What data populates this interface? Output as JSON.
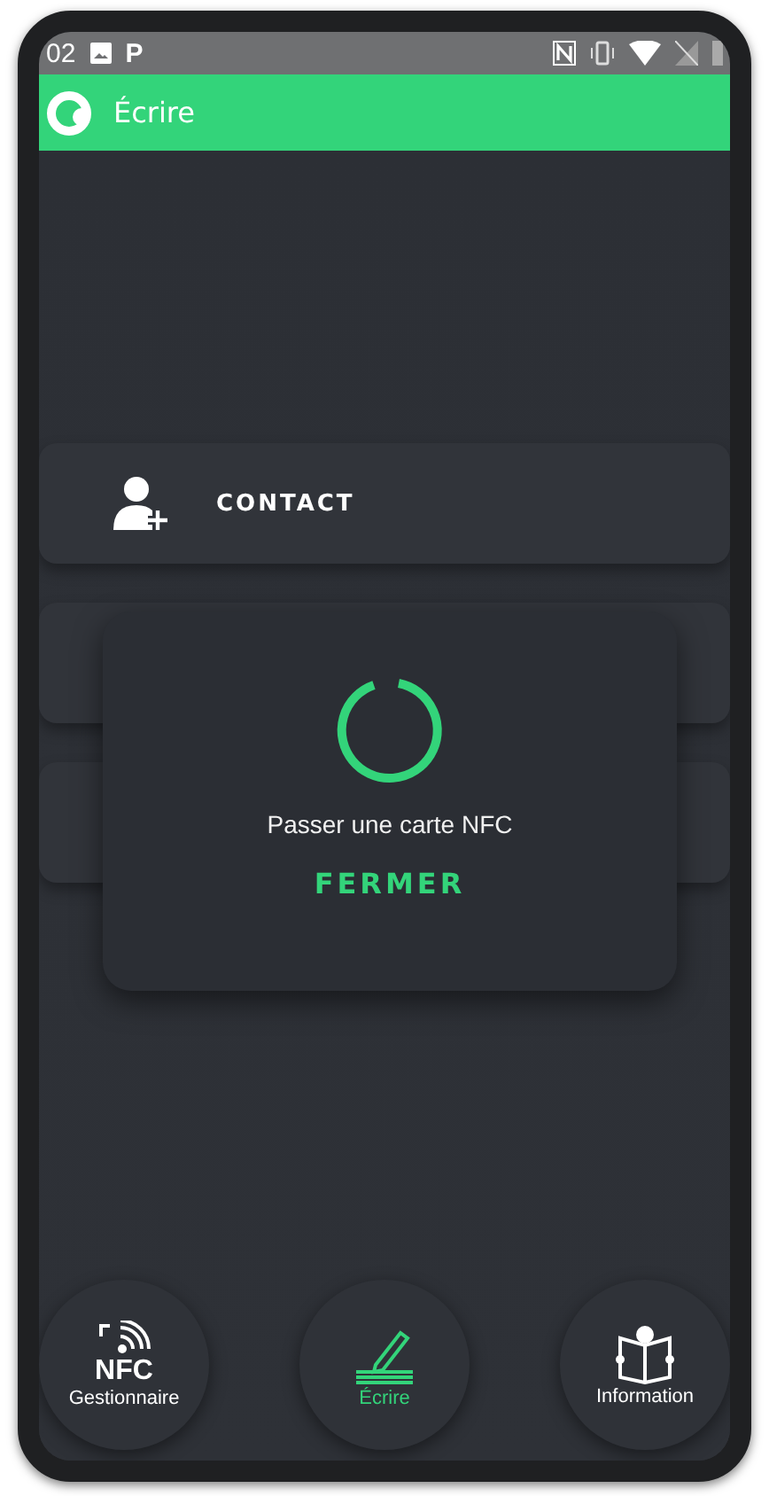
{
  "status_bar": {
    "time": "02",
    "app_letter": "P"
  },
  "app_bar": {
    "title": "Écrire"
  },
  "list": [
    {
      "kind": "item",
      "label": "CONTACT"
    },
    {
      "kind": "covered"
    },
    {
      "kind": "covered"
    }
  ],
  "dialog": {
    "message": "Passer une carte NFC",
    "button": "FERMER"
  },
  "nav": [
    {
      "label": "Gestionnaire",
      "tag": "NFC",
      "selected": false
    },
    {
      "label": "Écrire",
      "selected": true
    },
    {
      "label": "Information",
      "selected": false
    }
  ]
}
